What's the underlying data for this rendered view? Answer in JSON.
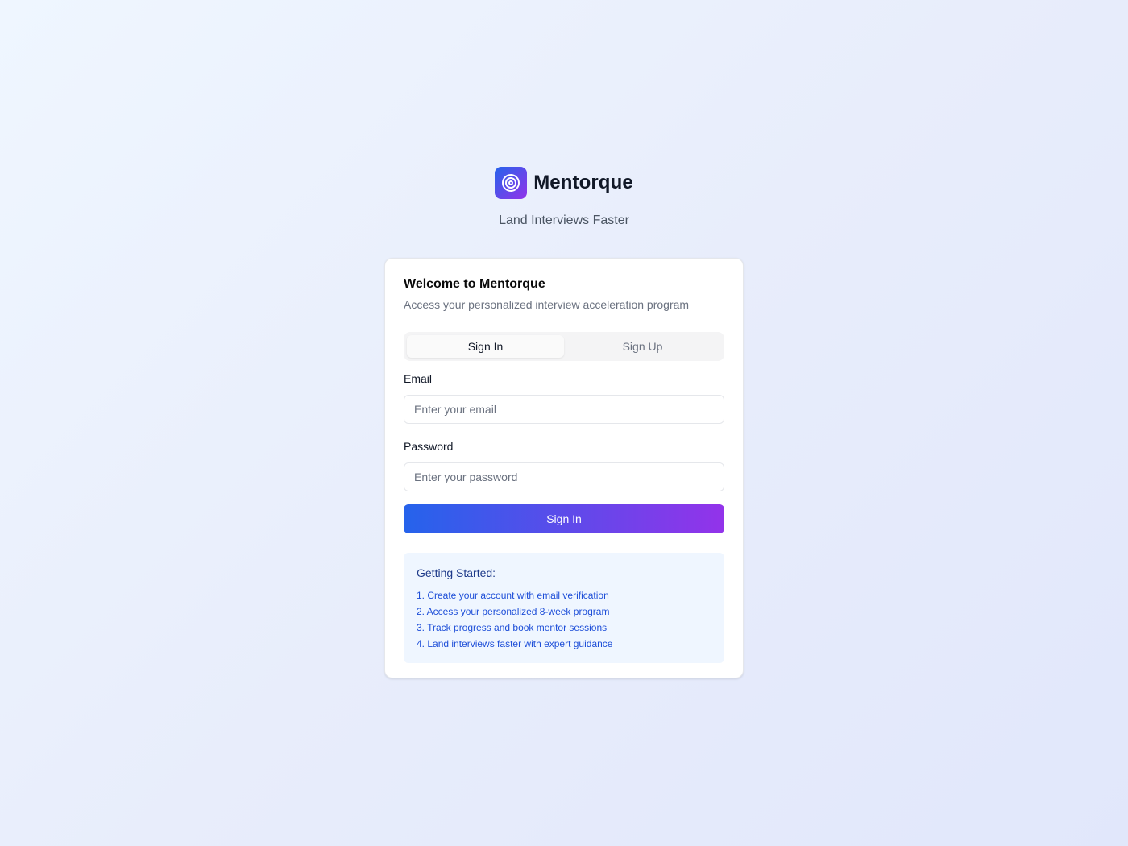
{
  "brand": {
    "name": "Mentorque",
    "tagline": "Land Interviews Faster",
    "logo_icon": "target-icon",
    "gradient_start": "#2563eb",
    "gradient_end": "#9333ea"
  },
  "card": {
    "title": "Welcome to Mentorque",
    "description": "Access your personalized interview acceleration program"
  },
  "tabs": [
    {
      "label": "Sign In",
      "active": true
    },
    {
      "label": "Sign Up",
      "active": false
    }
  ],
  "form": {
    "email_label": "Email",
    "email_placeholder": "Enter your email",
    "email_value": "",
    "password_label": "Password",
    "password_placeholder": "Enter your password",
    "password_value": "",
    "submit_label": "Sign In"
  },
  "getting_started": {
    "title": "Getting Started:",
    "steps": [
      "1. Create your account with email verification",
      "2. Access your personalized 8-week program",
      "3. Track progress and book mentor sessions",
      "4. Land interviews faster with expert guidance"
    ]
  }
}
